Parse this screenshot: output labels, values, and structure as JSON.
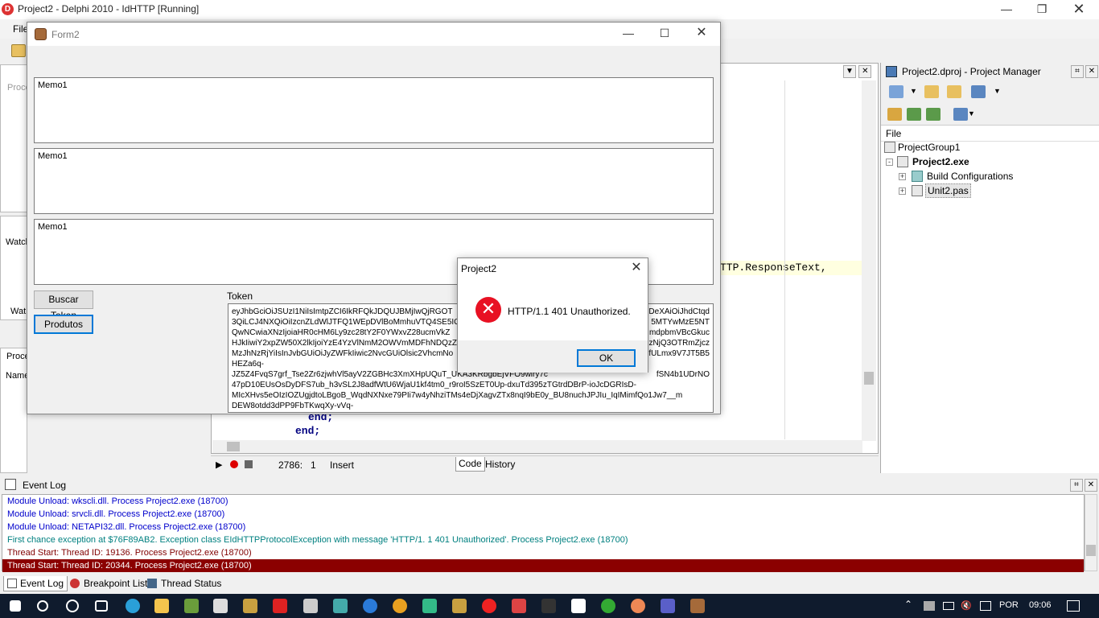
{
  "ide": {
    "title": "Project2 - Delphi 2010 - IdHTTP [Running]",
    "menu_file": "File",
    "left_panel_a": "Proce",
    "left_panel_watch": "Watch",
    "left_tab_watch": "Wat",
    "left_panel_b": "Proce",
    "left_panel_name": "Name"
  },
  "editor": {
    "visible_code": "TTP.ResponseText,",
    "code_line_1": "end;",
    "code_line_2": "end;",
    "status_position": "2786:   1",
    "status_mode": "Insert",
    "tab_code": "Code",
    "tab_history": "History"
  },
  "project_manager": {
    "title": "Project2.dproj - Project Manager",
    "column_header": "File",
    "tree": [
      {
        "label": "ProjectGroup1",
        "bold": false
      },
      {
        "label": "Project2.exe",
        "bold": true
      },
      {
        "label": "Build Configurations",
        "bold": false
      },
      {
        "label": "Unit2.pas",
        "bold": false
      }
    ]
  },
  "form2": {
    "title": "Form2",
    "memo1_text": "Memo1",
    "memo2_text": "Memo1",
    "memo3_text": "Memo1",
    "buscar_token_label": "Buscar Token",
    "produtos_label": "Produtos",
    "token_label": "Token",
    "token_lines": [
      "eyJhbGciOiJSUzI1NiIsImtpZCI6IkRFQkJDQUJBMjIwQjRGOT",
      "3QiLCJ4NXQiOiIzcnZLdWlJTFQ1WEpDVlBoMmhuVTQ4SE5IC",
      "QwNCwiaXNzIjoiaHR0cHM6Ly9zc28tY2F0YWxvZ28ucmVkZ",
      "HJkIiwiY2xpZW50X2lkIjoiYzE4YzVlNmM2OWVmMDFhNDQzZ",
      "MzJhNzRjYiIsInJvbGUiOiJyZWFkIiwic2NvcGUiOlsic2VhcmNo",
      "HEZa6q-",
      "JZ5Z4FvqS7grf_Tse2Zr6zjwhVl5ayV2ZGBHc3XmXHpUQuT_UKA3KRbgbEjVFO9wiry7c",
      "47pD10EUsOsDyDFS7ub_h3vSL2J8adfWtU6WjaU1kf4tm0_r9roI5SzET0Up-dxuTd395zTGtrdDBrP-ioJcDGRIsD-",
      "MIcXHvs5eOIzIOZUgjdtoLBgoB_WqdNXNxe79PIi7w4yNhziTMs4eDjXagvZTx8nqI9bE0y_BU8nuchJPJIu_IqIMimfQo1Jw7__m",
      "DEW8otdd3dPP9FbTKwqXy-vVq-"
    ],
    "token_line_tails": [
      "DeXAiOiJhdCtqd",
      "5MTYwMzE5NT",
      "mdpbmVBcGkuc",
      "zNjQ3OTRmZjcz",
      "fULmx9V7JT5B5",
      "",
      "fSN4b1UDrNO",
      "",
      "",
      ""
    ]
  },
  "dialog": {
    "title": "Project2",
    "message": "HTTP/1.1 401 Unauthorized.",
    "ok_label": "OK",
    "icon": "error-icon"
  },
  "event_log": {
    "title": "Event Log",
    "lines": [
      {
        "text": "Module Unload: wkscli.dll. Process Project2.exe (18700)",
        "color": "#0000cc"
      },
      {
        "text": "Module Unload: srvcli.dll. Process Project2.exe (18700)",
        "color": "#0000cc"
      },
      {
        "text": "Module Unload: NETAPI32.dll. Process Project2.exe (18700)",
        "color": "#0000cc"
      },
      {
        "text": "First chance exception at $76F89AB2. Exception class EIdHTTPProtocolException with message 'HTTP/1. 1 401 Unauthorized'. Process Project2.exe (18700)",
        "color": "#008080"
      },
      {
        "text": "Thread Start: Thread ID: 19136. Process Project2.exe (18700)",
        "color": "#800000"
      },
      {
        "text": "Thread Start: Thread ID: 20344. Process Project2.exe (18700)",
        "color": "#ffffff",
        "selected": true
      }
    ],
    "tabs": [
      "Event Log",
      "Breakpoint List",
      "Thread Status"
    ]
  },
  "taskbar": {
    "language": "POR",
    "time": "09:06"
  },
  "colors": {
    "selection": "#8b0000",
    "dialog_accent": "#0078d7",
    "error": "#e81123",
    "taskbar": "#0f1b2d"
  }
}
